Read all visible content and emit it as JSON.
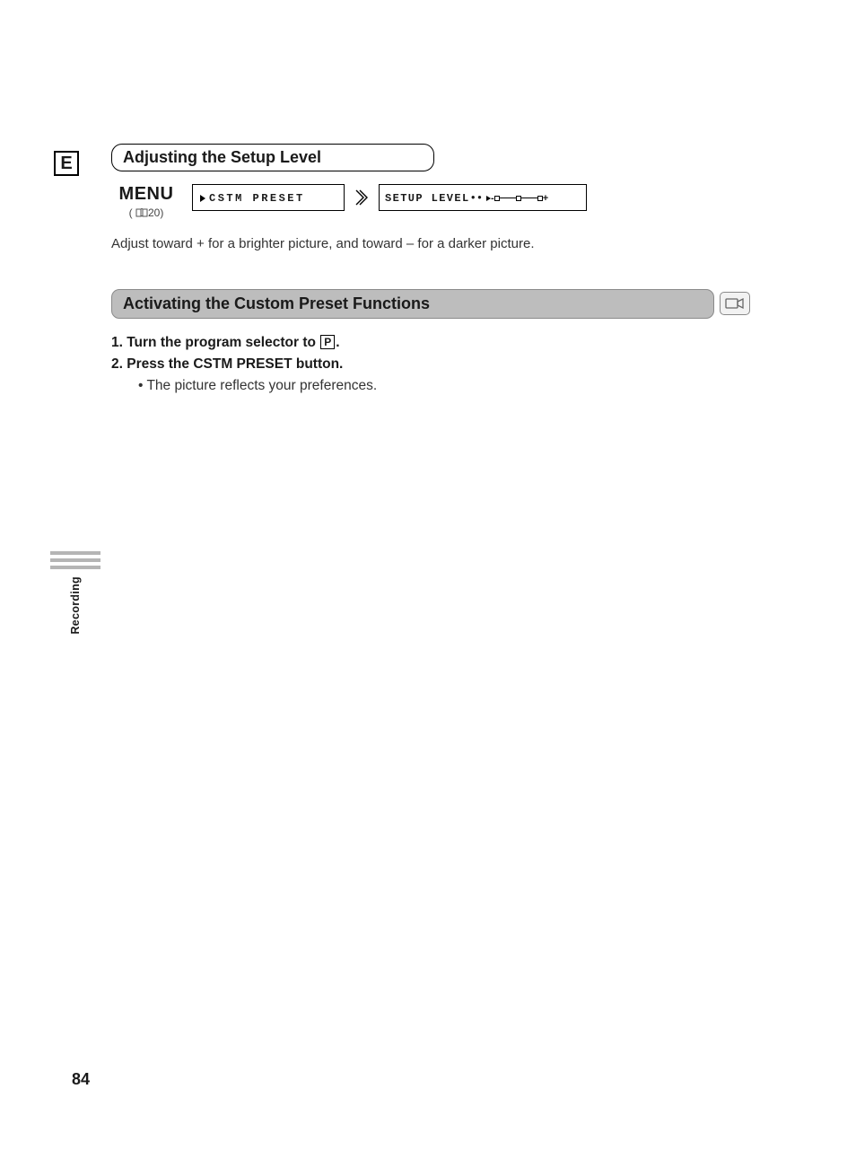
{
  "lang_indicator": "E",
  "section1_title": "Adjusting the Setup Level",
  "menu": {
    "label": "MENU",
    "ref_prefix": "( ",
    "ref_page": "20",
    "ref_suffix": ")"
  },
  "path": {
    "box1": "CSTM PRESET",
    "box2": "SETUP LEVEL",
    "slider_minus": "-",
    "slider_plus": "+"
  },
  "adjust_note": "Adjust toward + for a brighter picture, and toward – for a darker picture.",
  "section2_title": "Activating the Custom Preset Functions",
  "steps": {
    "s1_prefix": "1.  Turn the program selector to ",
    "s1_icon": "P",
    "s1_suffix": ".",
    "s2": "2.  Press the CSTM PRESET button.",
    "bullet": "• The picture reflects your preferences."
  },
  "side_label": "Recording",
  "page_number": "84"
}
